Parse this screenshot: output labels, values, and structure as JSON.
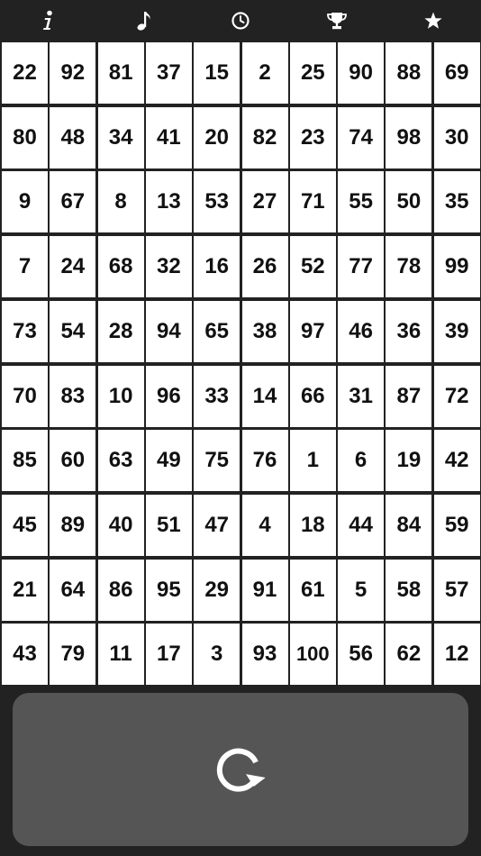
{
  "toolbar": {
    "items": [
      {
        "id": "info",
        "icon": "info-icon"
      },
      {
        "id": "music",
        "icon": "music-note-icon"
      },
      {
        "id": "timer",
        "icon": "clock-icon"
      },
      {
        "id": "trophy",
        "icon": "trophy-icon"
      },
      {
        "id": "star",
        "icon": "star-icon"
      }
    ],
    "icon_color": "#ffffff",
    "background": "#222222"
  },
  "board": {
    "rows": [
      [
        "22",
        "92",
        "81",
        "37",
        "15",
        "2",
        "25",
        "90",
        "88",
        "69"
      ],
      [
        "80",
        "48",
        "34",
        "41",
        "20",
        "82",
        "23",
        "74",
        "98",
        "30"
      ],
      [
        "9",
        "67",
        "8",
        "13",
        "53",
        "27",
        "71",
        "55",
        "50",
        "35"
      ],
      [
        "7",
        "24",
        "68",
        "32",
        "16",
        "26",
        "52",
        "77",
        "78",
        "99"
      ],
      [
        "73",
        "54",
        "28",
        "94",
        "65",
        "38",
        "97",
        "46",
        "36",
        "39"
      ],
      [
        "70",
        "83",
        "10",
        "96",
        "33",
        "14",
        "66",
        "31",
        "87",
        "72"
      ],
      [
        "85",
        "60",
        "63",
        "49",
        "75",
        "76",
        "1",
        "6",
        "19",
        "42"
      ],
      [
        "45",
        "89",
        "40",
        "51",
        "47",
        "4",
        "18",
        "44",
        "84",
        "59"
      ],
      [
        "21",
        "64",
        "86",
        "95",
        "29",
        "91",
        "61",
        "5",
        "58",
        "57"
      ],
      [
        "43",
        "79",
        "11",
        "17",
        "3",
        "93",
        "100",
        "56",
        "62",
        "12"
      ]
    ],
    "cell_color": "#ffffff",
    "text_color": "#111111"
  },
  "restart": {
    "icon": "restart-icon",
    "panel_color": "#555555"
  }
}
